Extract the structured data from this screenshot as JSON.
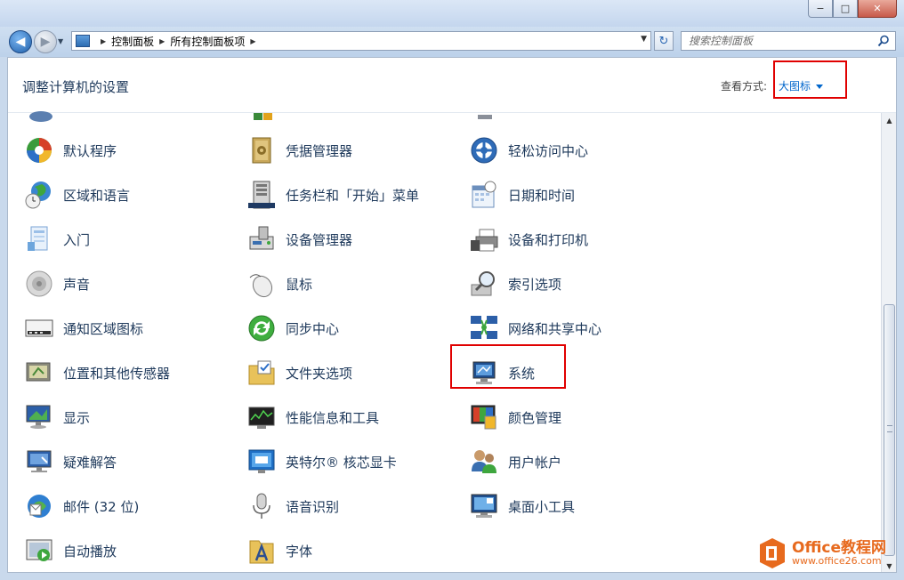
{
  "window": {
    "caption": {
      "minimize": "−",
      "maximize": "□",
      "close": "✕"
    }
  },
  "address_bar": {
    "crumbs": [
      "控制面板",
      "所有控制面板项"
    ],
    "search_placeholder": "搜索控制面板"
  },
  "header": {
    "title": "调整计算机的设置",
    "view_label": "查看方式:",
    "view_value": "大图标"
  },
  "items": {
    "col1": [
      "默认程序",
      "区域和语言",
      "入门",
      "声音",
      "通知区域图标",
      "位置和其他传感器",
      "显示",
      "疑难解答",
      "邮件 (32 位)",
      "自动播放"
    ],
    "col2": [
      "凭据管理器",
      "任务栏和「开始」菜单",
      "设备管理器",
      "鼠标",
      "同步中心",
      "文件夹选项",
      "性能信息和工具",
      "英特尔® 核芯显卡",
      "语音识别",
      "字体"
    ],
    "col3": [
      "轻松访问中心",
      "日期和时间",
      "设备和打印机",
      "索引选项",
      "网络和共享中心",
      "系统",
      "颜色管理",
      "用户帐户",
      "桌面小工具"
    ]
  },
  "watermark": {
    "title": "Office教程网",
    "url": "www.office26.com"
  },
  "colors": {
    "accent": "#0066cc",
    "label": "#1e395b",
    "highlight": "#e00000",
    "watermark": "#e76a1e"
  }
}
